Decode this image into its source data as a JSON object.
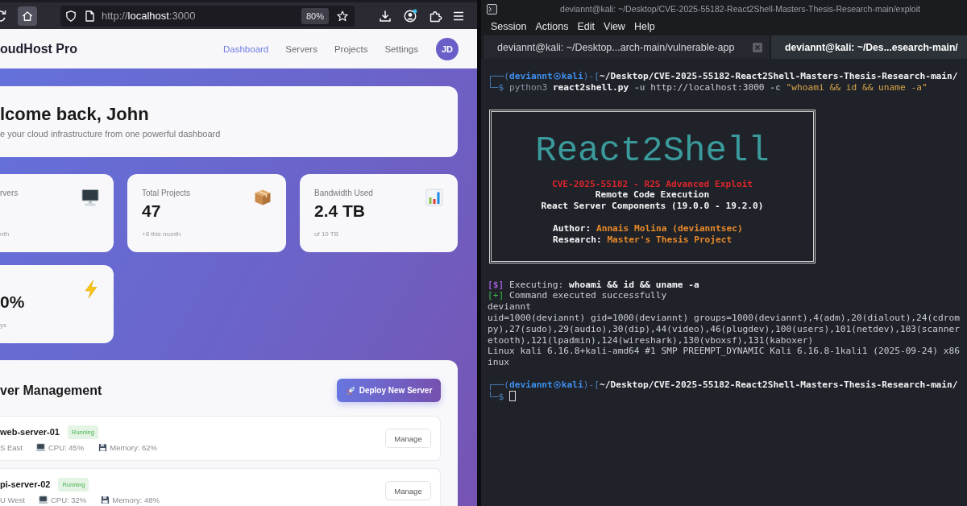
{
  "browser": {
    "toolbar": {
      "url": "http://**localhost**:3000",
      "zoom": "80%"
    },
    "page": {
      "brand": "oudHost Pro",
      "nav": [
        {
          "label": "Dashboard",
          "selected": true
        },
        {
          "label": "Servers",
          "selected": false
        },
        {
          "label": "Projects",
          "selected": false
        },
        {
          "label": "Settings",
          "selected": false
        }
      ],
      "avatar": "JD",
      "welcome": {
        "title": "lcome back, John",
        "subtitle": "e your cloud infrastructure from one powerful dashboard"
      },
      "stats": [
        {
          "kind": "monitor",
          "label": "rvers",
          "note": "nth"
        },
        {
          "kind": "package",
          "label": "Total Projects",
          "value": "47",
          "note": "+8 this month"
        },
        {
          "kind": "chart",
          "label": "Bandwidth Used",
          "value": "2.4 TB",
          "note": "of 10 TB"
        },
        {
          "kind": "bolt",
          "value": "0%",
          "note": "ys"
        }
      ],
      "server_management": {
        "title": "ver Management",
        "deploy_button": "Deploy New Server",
        "servers": [
          {
            "name": "web-server-01",
            "status": "Running",
            "region": "S East",
            "cpu": "CPU: 45%",
            "memory": "Memory: 62%",
            "action": "Manage"
          },
          {
            "name": "pi-server-02",
            "status": "Running",
            "region": "U West",
            "cpu": "CPU: 32%",
            "memory": "Memory: 48%",
            "action": "Manage"
          }
        ]
      }
    }
  },
  "terminal": {
    "title": "deviannt@kali: ~/Desktop/CVE-2025-55182-React2Shell-Masters-Thesis-Research-main/exploit",
    "menu": [
      "Session",
      "Actions",
      "Edit",
      "View",
      "Help"
    ],
    "tabs": [
      {
        "label": "deviannt@kali: ~/Desktop...arch-main/vulnerable-app",
        "selected": false
      },
      {
        "label": "deviannt@kali: ~/Des...esearch-main/",
        "selected": true
      }
    ],
    "lines": [
      {
        "kind": "prompt",
        "lead": "┌──(",
        "user": "deviannt",
        "host": "kali",
        "separator": ")-[",
        "path": "~/Desktop/CVE-2025-55182-React2Shell-Masters-Thesis-Research-main/"
      },
      {
        "kind": "command",
        "lead": "└─$",
        "segments": [
          {
            "text": "python3",
            "color": "#8d96a6",
            "bold": false
          },
          {
            "text": "react2shell.py",
            "color": "#f4f4f6",
            "bold": true
          },
          {
            "text": "-u",
            "color": "#8d96a6",
            "bold": true
          },
          {
            "text": "http://localhost:3000",
            "color": "#c9ccd3",
            "bold": false
          },
          {
            "text": "-c",
            "color": "#8d96a6",
            "bold": true
          },
          {
            "text": "\"whoami && id && uname -a\"",
            "color": "#d8a44c",
            "bold": false
          }
        ]
      },
      {
        "kind": "banner",
        "art": "React2Shell",
        "rows": [
          {
            "text": "CVE-2025-55182 - R2S Advanced Exploit",
            "color": "#d9262c"
          },
          {
            "text": "Remote Code Execution",
            "color": "#f4f4f6"
          },
          {
            "text": "React Server Components (19.0.0 - 19.2.0)",
            "color": "#f4f4f6"
          }
        ],
        "credits": [
          {
            "label": "Author:",
            "value": "Annais Molina (devianntsec)"
          },
          {
            "label": "Research:",
            "value": "Master's Thesis Project"
          }
        ]
      },
      {
        "kind": "output",
        "segments": [
          {
            "text": "[$]",
            "color": "#9b5bd1",
            "bold": true
          },
          {
            "text": "Executing:",
            "color": "#c9ccd3",
            "bold": false
          },
          {
            "text": "whoami && id && uname -a",
            "color": "#f4f4f6",
            "bold": true
          }
        ]
      },
      {
        "kind": "output",
        "segments": [
          {
            "text": "[+]",
            "color": "#3fb950",
            "bold": false
          },
          {
            "text": "Command executed successfully",
            "color": "#c9ccd3",
            "bold": false
          }
        ]
      },
      {
        "kind": "output",
        "segments": [
          {
            "text": "deviannt",
            "color": "#c9ccd3",
            "bold": false
          }
        ]
      },
      {
        "kind": "output",
        "segments": [
          {
            "text": "uid=1000(deviannt) gid=1000(deviannt) groups=1000(deviannt),4(adm),20(dialout),24(cdrom",
            "color": "#c9ccd3",
            "bold": false
          }
        ]
      },
      {
        "kind": "output",
        "segments": [
          {
            "text": "py),27(sudo),29(audio),30(dip),44(video),46(plugdev),100(users),101(netdev),103(scanner",
            "color": "#c9ccd3",
            "bold": false
          }
        ]
      },
      {
        "kind": "output",
        "segments": [
          {
            "text": "etooth),121(lpadmin),124(wireshark),130(vboxsf),131(kaboxer)",
            "color": "#c9ccd3",
            "bold": false
          }
        ]
      },
      {
        "kind": "output",
        "segments": [
          {
            "text": "Linux kali 6.16.8+kali-amd64 #1 SMP PREEMPT_DYNAMIC Kali 6.16.8-1kali1 (2025-09-24) x86",
            "color": "#c9ccd3",
            "bold": false
          }
        ]
      },
      {
        "kind": "output",
        "segments": [
          {
            "text": "inux",
            "color": "#c9ccd3",
            "bold": false
          }
        ]
      },
      {
        "kind": "prompt",
        "lead": "┌──(",
        "user": "deviannt",
        "host": "kali",
        "separator": ")-[",
        "path": "~/Desktop/CVE-2025-55182-React2Shell-Masters-Thesis-Research-main/"
      },
      {
        "kind": "cursor",
        "lead": "└─$"
      }
    ]
  }
}
